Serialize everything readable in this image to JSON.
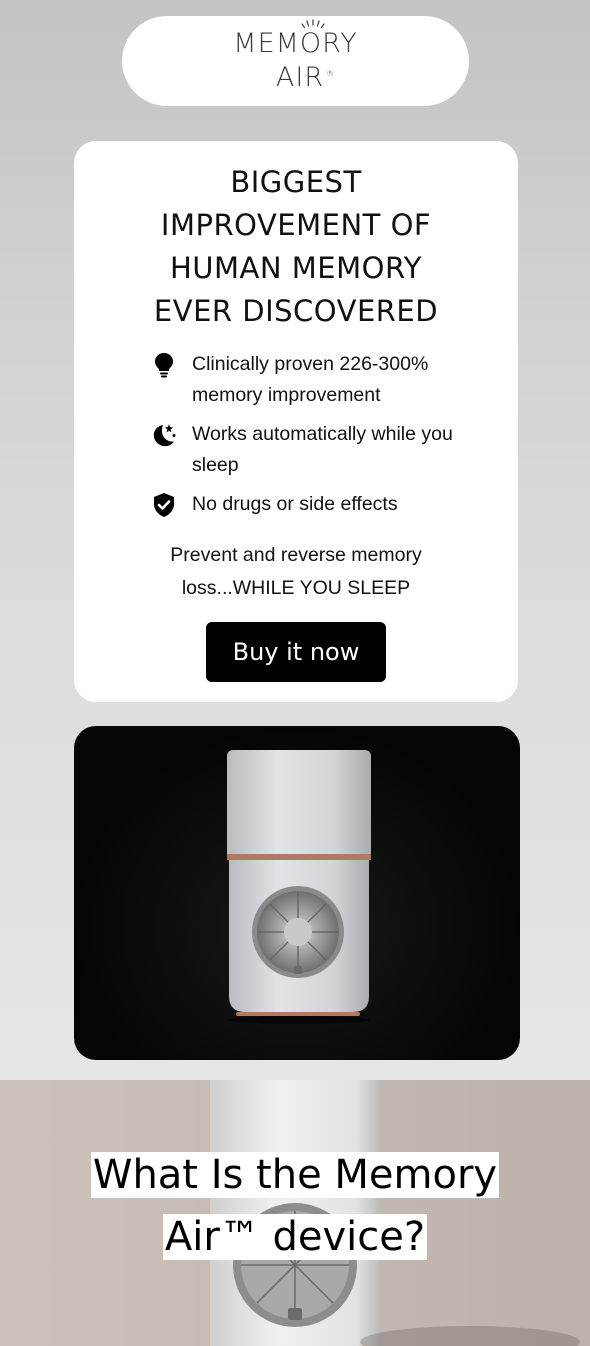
{
  "logo": {
    "line1": "MEMORY",
    "line2": "AIR",
    "registered_mark": "®"
  },
  "hero": {
    "headline_lines": [
      "BIGGEST",
      "IMPROVEMENT OF",
      "HUMAN MEMORY",
      "EVER DISCOVERED"
    ],
    "features": [
      {
        "icon": "lightbulb-icon",
        "text": "Clinically proven 226-300% memory improvement"
      },
      {
        "icon": "moon-stars-icon",
        "text": "Works automatically while you sleep"
      },
      {
        "icon": "shield-check-icon",
        "text": "No drugs or side effects"
      }
    ],
    "tagline_line1": "Prevent and reverse memory",
    "tagline_line2": "loss...WHILE YOU SLEEP",
    "cta_label": "Buy it now"
  },
  "section": {
    "heading_line1": "What Is the Memory",
    "heading_line2": "Air™ device?"
  },
  "colors": {
    "button_bg": "#000000",
    "accent_copper": "#b07a62",
    "card_bg": "#ffffff"
  }
}
